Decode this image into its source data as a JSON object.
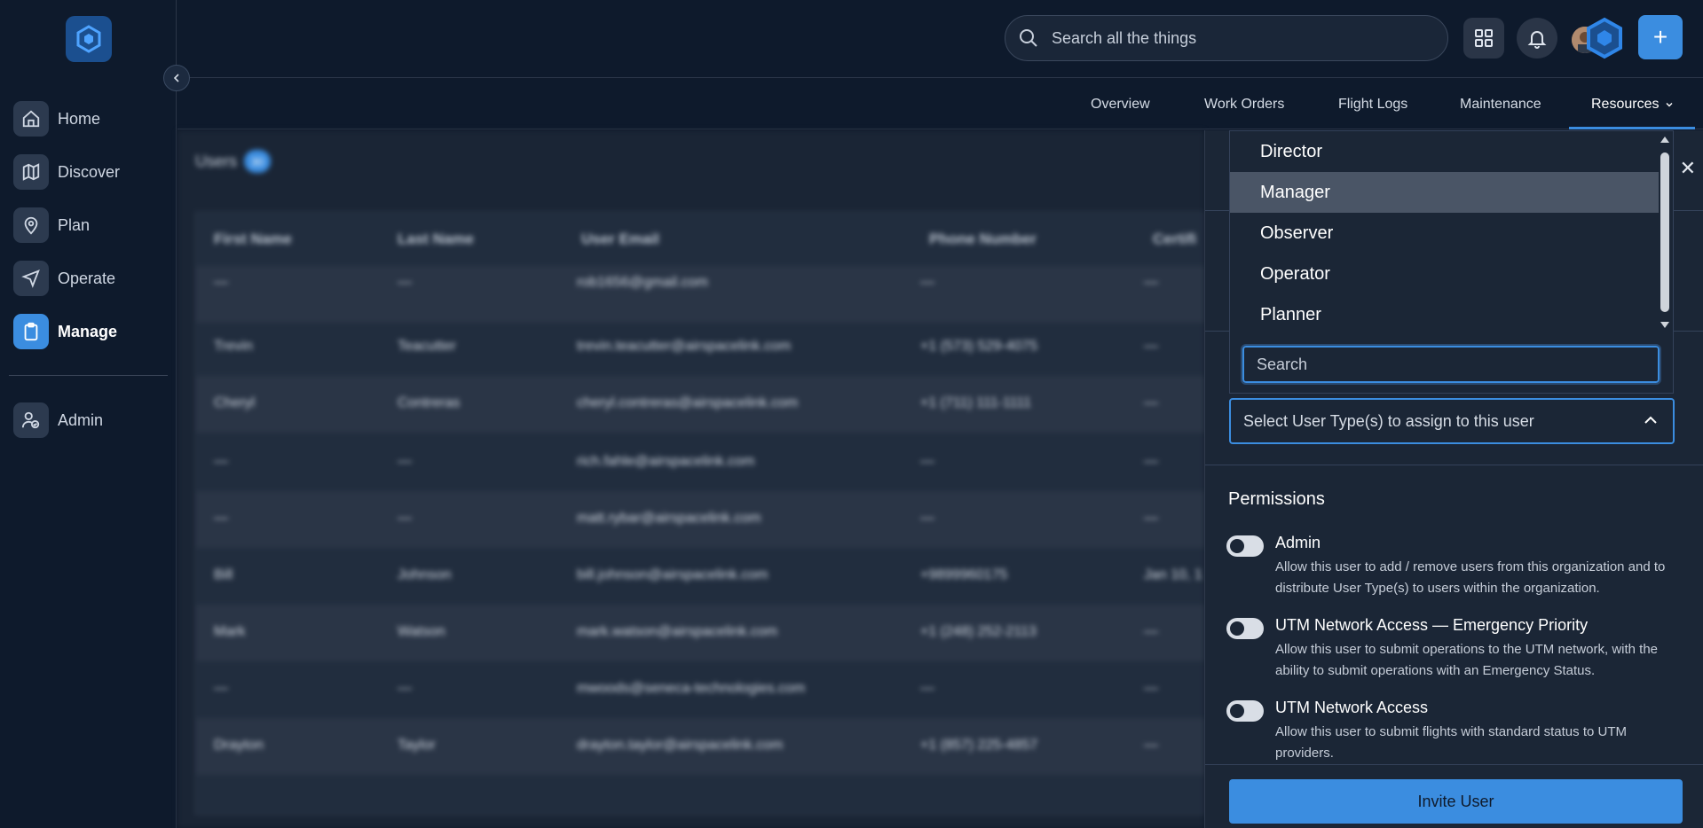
{
  "sidebar": {
    "items": [
      {
        "label": "Home",
        "icon": "home-icon"
      },
      {
        "label": "Discover",
        "icon": "map-icon"
      },
      {
        "label": "Plan",
        "icon": "map-pin-icon"
      },
      {
        "label": "Operate",
        "icon": "send-icon"
      },
      {
        "label": "Manage",
        "icon": "clipboard-icon"
      },
      {
        "label": "Admin",
        "icon": "user-check-icon"
      }
    ],
    "active": "Manage"
  },
  "header": {
    "search_placeholder": "Search all the things"
  },
  "subnav": {
    "tabs": [
      "Overview",
      "Work Orders",
      "Flight Logs",
      "Maintenance",
      "Resources"
    ],
    "active": "Resources"
  },
  "users": {
    "title": "Users",
    "count": "30",
    "columns": [
      "First Name",
      "Last Name",
      "User Email",
      "Phone Number",
      "Certifi"
    ],
    "rows": [
      [
        "—",
        "—",
        "rob1656@gmail.com",
        "—",
        "—"
      ],
      [
        "Trevin",
        "Teacutter",
        "trevin.teacutter@airspacelink.com",
        "+1 (573) 529-4075",
        "—"
      ],
      [
        "Cheryl",
        "Contreras",
        "cheryl.contreras@airspacelink.com",
        "+1 (711) 111-1111",
        "—"
      ],
      [
        "—",
        "—",
        "rich.fahle@airspacelink.com",
        "—",
        "—"
      ],
      [
        "—",
        "—",
        "matt.rybar@airspacelink.com",
        "—",
        "—"
      ],
      [
        "Bill",
        "Johnson",
        "bill.johnson@airspacelink.com",
        "+9899960175",
        "Jan 10, 1"
      ],
      [
        "Mark",
        "Watson",
        "mark.watson@airspacelink.com",
        "+1 (248) 252-2113",
        "—"
      ],
      [
        "—",
        "—",
        "mwoods@seneca-technologies.com",
        "—",
        "—"
      ],
      [
        "Drayton",
        "Taylor",
        "drayton.taylor@airspacelink.com",
        "+1 (857) 225-4857",
        "—"
      ]
    ]
  },
  "dropdown": {
    "options": [
      "Director",
      "Manager",
      "Observer",
      "Operator",
      "Planner"
    ],
    "highlighted": "Manager",
    "search_placeholder": "Search"
  },
  "panel": {
    "select_placeholder": "Select User Type(s) to assign to this user",
    "permissions_title": "Permissions",
    "permissions": [
      {
        "name": "Admin",
        "description": "Allow this user to add / remove users from this organization and to distribute User Type(s) to users within the organization.",
        "enabled": false
      },
      {
        "name": "UTM Network Access — Emergency Priority",
        "description": "Allow this user to submit operations to the UTM network, with the ability to submit operations with an Emergency Status.",
        "enabled": false
      },
      {
        "name": "UTM Network Access",
        "description": "Allow this user to submit flights with standard status to UTM providers.",
        "enabled": false
      }
    ],
    "invite_label": "Invite User"
  },
  "colors": {
    "accent": "#3b8de0",
    "background": "#0e1a2c",
    "panel": "#1b2636"
  }
}
